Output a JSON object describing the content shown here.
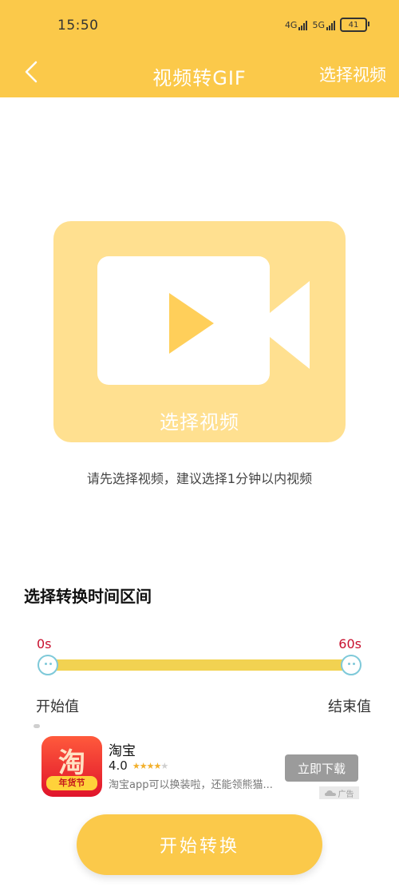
{
  "status_bar": {
    "time": "15:50",
    "signal1": "4G",
    "signal2": "5G",
    "battery": "41"
  },
  "nav": {
    "title": "视频转GIF",
    "action": "选择视频"
  },
  "video_card": {
    "label": "选择视频"
  },
  "hint": "请先选择视频，建议选择1分钟以内视频",
  "range_section": {
    "title": "选择转换时间区间",
    "min_label": "0s",
    "max_label": "60s",
    "start_label": "开始值",
    "end_label": "结束值",
    "start_value_fraction": 0,
    "end_value_fraction": 1
  },
  "ad": {
    "app_icon_text": "淘",
    "app_icon_sub": "年货节",
    "name": "淘宝",
    "rating": "4.0",
    "stars": 4,
    "description": "淘宝app可以换装啦，还能领熊猫...",
    "download_label": "立即下载",
    "tag": "广告"
  },
  "main_button": {
    "label": "开始转换"
  },
  "colors": {
    "brand": "#FBC94A",
    "card": "#FFE090",
    "track": "#F2D251",
    "range_label": "#C8102E",
    "handle": "#7EC9D9"
  }
}
